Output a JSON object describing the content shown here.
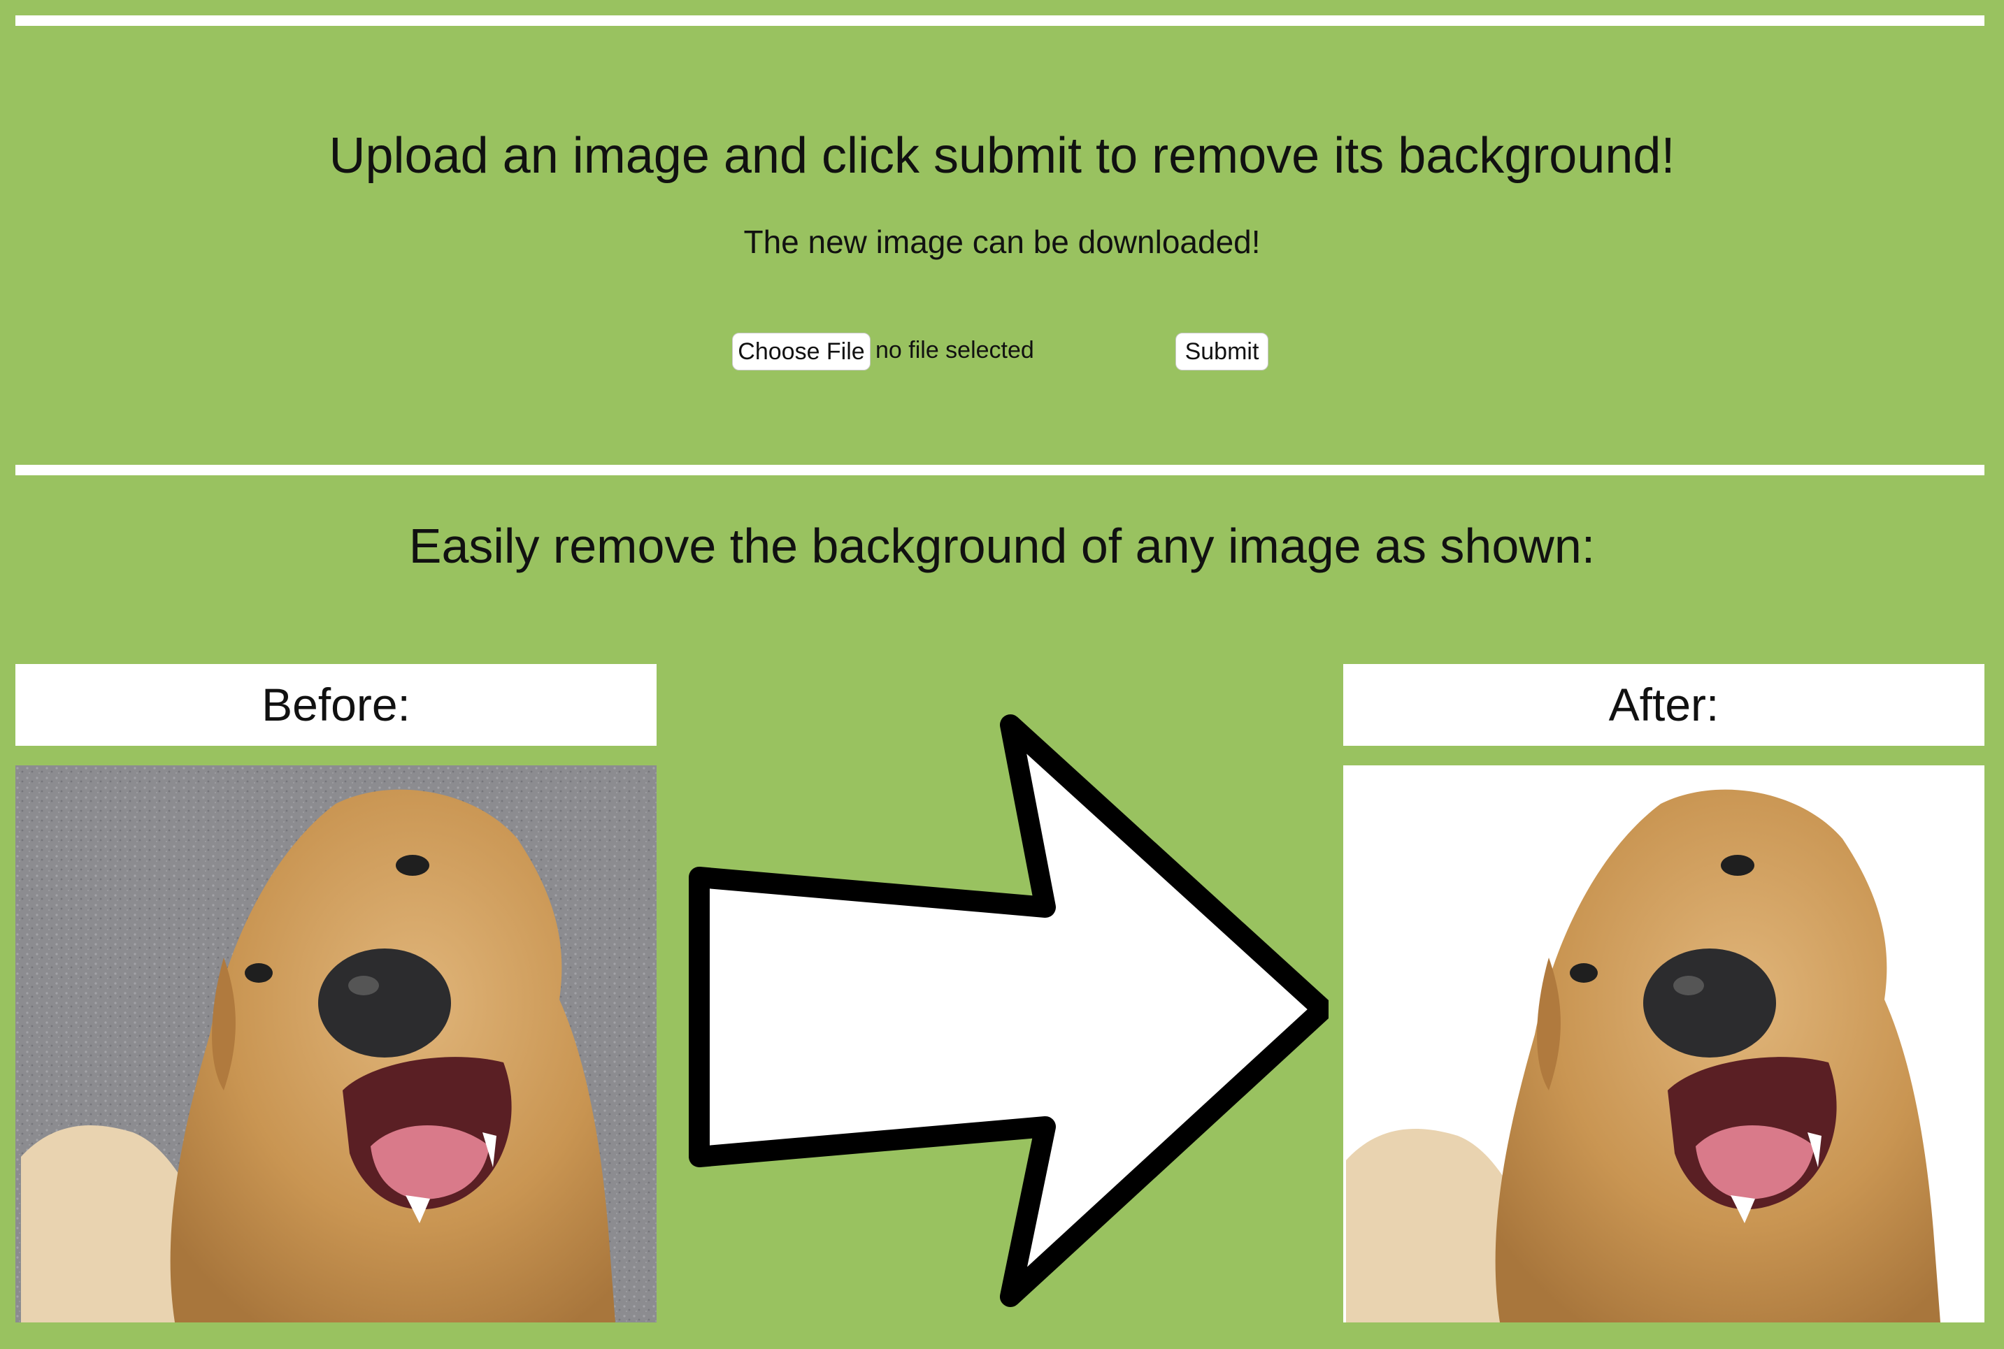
{
  "colors": {
    "background": "#99c260",
    "panel": "#ffffff",
    "arrow_fill": "#ffffff",
    "arrow_stroke": "#000000",
    "ground": "#8a8a8c",
    "dog_fur": "#c99a5a"
  },
  "upload": {
    "title": "Upload an image and click submit to remove its background!",
    "subtitle": "The new image can be downloaded!",
    "choose_file_label": "Choose File",
    "file_status": "no file selected",
    "submit_label": "Submit"
  },
  "example": {
    "heading": "Easily remove the background of any image as shown:",
    "before_label": "Before:",
    "after_label": "After:",
    "arrow_icon": "right-arrow-icon",
    "before_image": "golden-retriever-photo-with-ground",
    "after_image": "golden-retriever-photo-background-removed"
  }
}
